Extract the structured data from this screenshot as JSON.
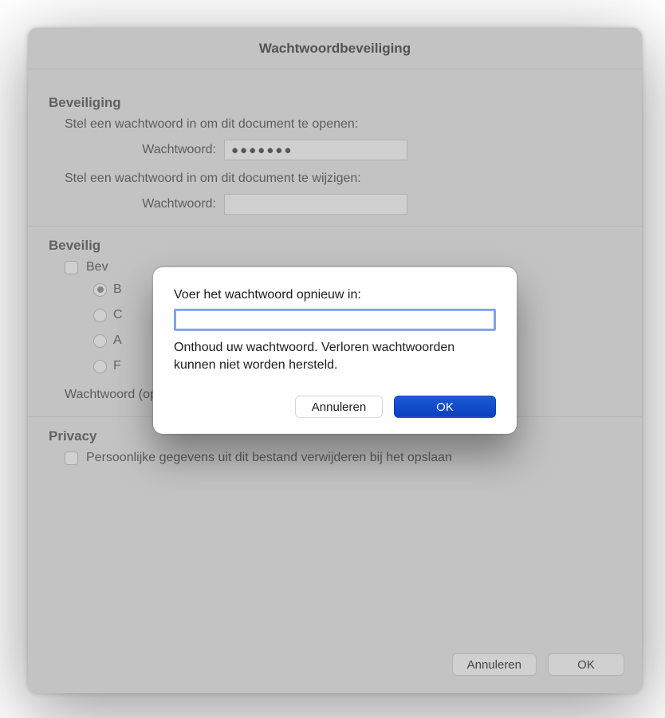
{
  "window": {
    "title": "Wachtwoordbeveiliging"
  },
  "security": {
    "heading": "Beveiliging",
    "open_instruction": "Stel een wachtwoord in om dit document te openen:",
    "modify_instruction": "Stel een wachtwoord in om dit document te wijzigen:",
    "password_label": "Wachtwoord:",
    "open_value_masked": "●●●●●●●",
    "modify_value_masked": ""
  },
  "security_options": {
    "heading": "Beveilig",
    "checkbox_label": "Bev",
    "radios": [
      "B",
      "C",
      "A",
      "F"
    ],
    "selected_index": 0,
    "optional_password_label": "Wachtwoord (optioneel):"
  },
  "privacy": {
    "heading": "Privacy",
    "checkbox_label": "Persoonlijke gegevens uit dit bestand verwijderen bij het opslaan"
  },
  "back_buttons": {
    "cancel": "Annuleren",
    "ok": "OK"
  },
  "sheet": {
    "prompt": "Voer het wachtwoord opnieuw in:",
    "note": "Onthoud uw wachtwoord. Verloren wachtwoorden kunnen niet worden hersteld.",
    "cancel": "Annuleren",
    "ok": "OK",
    "input_value": ""
  }
}
